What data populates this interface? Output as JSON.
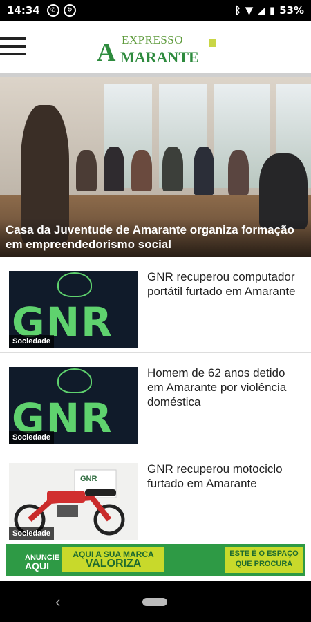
{
  "status_bar": {
    "time": "14:34",
    "icons": [
      "whatsapp-icon",
      "sync-icon"
    ],
    "right_icons": [
      "bluetooth-icon",
      "wifi-icon",
      "signal-icon",
      "battery-icon"
    ],
    "battery": "53%"
  },
  "header": {
    "menu_icon": "hamburger-icon",
    "logo_top": "EXPRESSO",
    "logo_initial": "A",
    "logo_bottom": "MARANTE"
  },
  "hero": {
    "title": "Casa da Juventude de Amarante organiza formação em empreendedorismo social"
  },
  "articles": [
    {
      "category": "Sociedade",
      "title": "GNR recuperou computador portátil furtado em Amarante",
      "thumb": "gnr"
    },
    {
      "category": "Sociedade",
      "title": "Homem de 62 anos detido em Amarante por violência doméstica",
      "thumb": "gnr"
    },
    {
      "category": "Sociedade",
      "title": "GNR recuperou motociclo furtado em Amarante",
      "thumb": "moto"
    }
  ],
  "thumb_text": {
    "gnr": "GNR",
    "moto_sign": "GNR"
  },
  "ad": {
    "left_top": "ANUNCIE",
    "left_bottom": "AQUI",
    "mid_top": "AQUI A SUA MARCA",
    "mid_bottom": "VALORIZA",
    "right_top": "ESTE É O ESPAÇO",
    "right_bottom": "QUE PROCURA"
  },
  "colors": {
    "brand_green": "#2e8b3e",
    "gnr_green": "#5fd26e",
    "ad_lime": "#c8d92b"
  }
}
